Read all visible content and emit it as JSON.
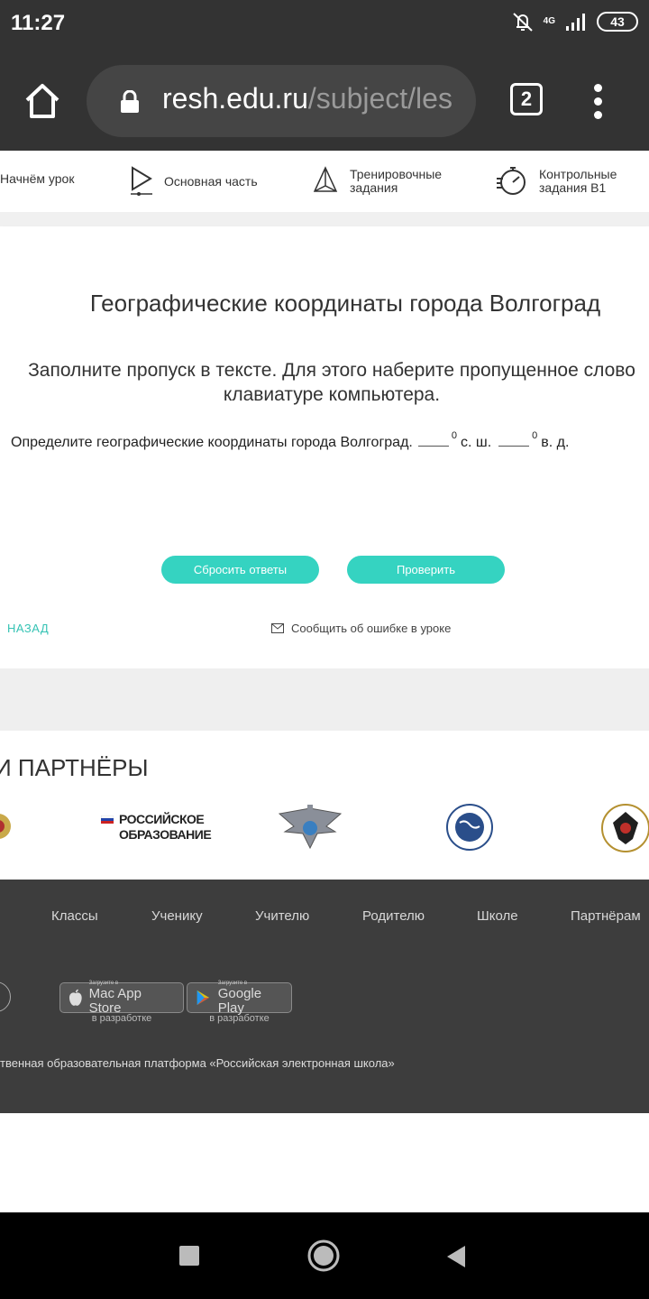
{
  "status_bar": {
    "time": "11:27",
    "network": "4G",
    "battery": "43"
  },
  "browser": {
    "url_host": "resh.edu.ru",
    "url_path": "/subject/les",
    "tabs_count": "2"
  },
  "lesson_nav": [
    {
      "label": "Начнём урок",
      "icon": "lesson-start-icon"
    },
    {
      "label": "Основная часть",
      "icon": "play-icon"
    },
    {
      "label_line1": "Тренировочные",
      "label_line2": "задания",
      "icon": "pyramid-icon"
    },
    {
      "label_line1": "Контрольные",
      "label_line2": "задания B1",
      "icon": "timer-icon"
    }
  ],
  "task": {
    "title": "Географические координаты города Волгоград",
    "instruction_line1": "Заполните пропуск в тексте. Для этого наберите пропущенное слово",
    "instruction_line2": "клавиатуре компьютера.",
    "question": "Определите географические координаты города Волгоград.",
    "degree_mark": "0",
    "unit_lat": "с. ш.",
    "unit_lon": "в. д.",
    "answer_lat": "",
    "answer_lon": ""
  },
  "buttons": {
    "reset": "Сбросить ответы",
    "check": "Проверить"
  },
  "links": {
    "back": "НАЗАД",
    "report_error": "Сообщить об ошибке в уроке"
  },
  "partners": {
    "title": "И ПАРТНЁРЫ",
    "logo_ro_line1": "РОССИЙСКОЕ",
    "logo_ro_line2": "ОБРАЗОВАНИЕ"
  },
  "footer": {
    "links": [
      "Классы",
      "Ученику",
      "Учителю",
      "Родителю",
      "Школе",
      "Партнёрам"
    ],
    "app_store_small": "Загрузите в",
    "app_store_big": "Mac App Store",
    "google_play_small": "Загрузите в",
    "google_play_big": "Google Play",
    "in_development": "в разработке",
    "copyright": "твенная образовательная платформа «Российская электронная школа»"
  },
  "colors": {
    "accent": "#35d3c1",
    "dark": "#333333",
    "footer_bg": "#3d3d3d"
  }
}
